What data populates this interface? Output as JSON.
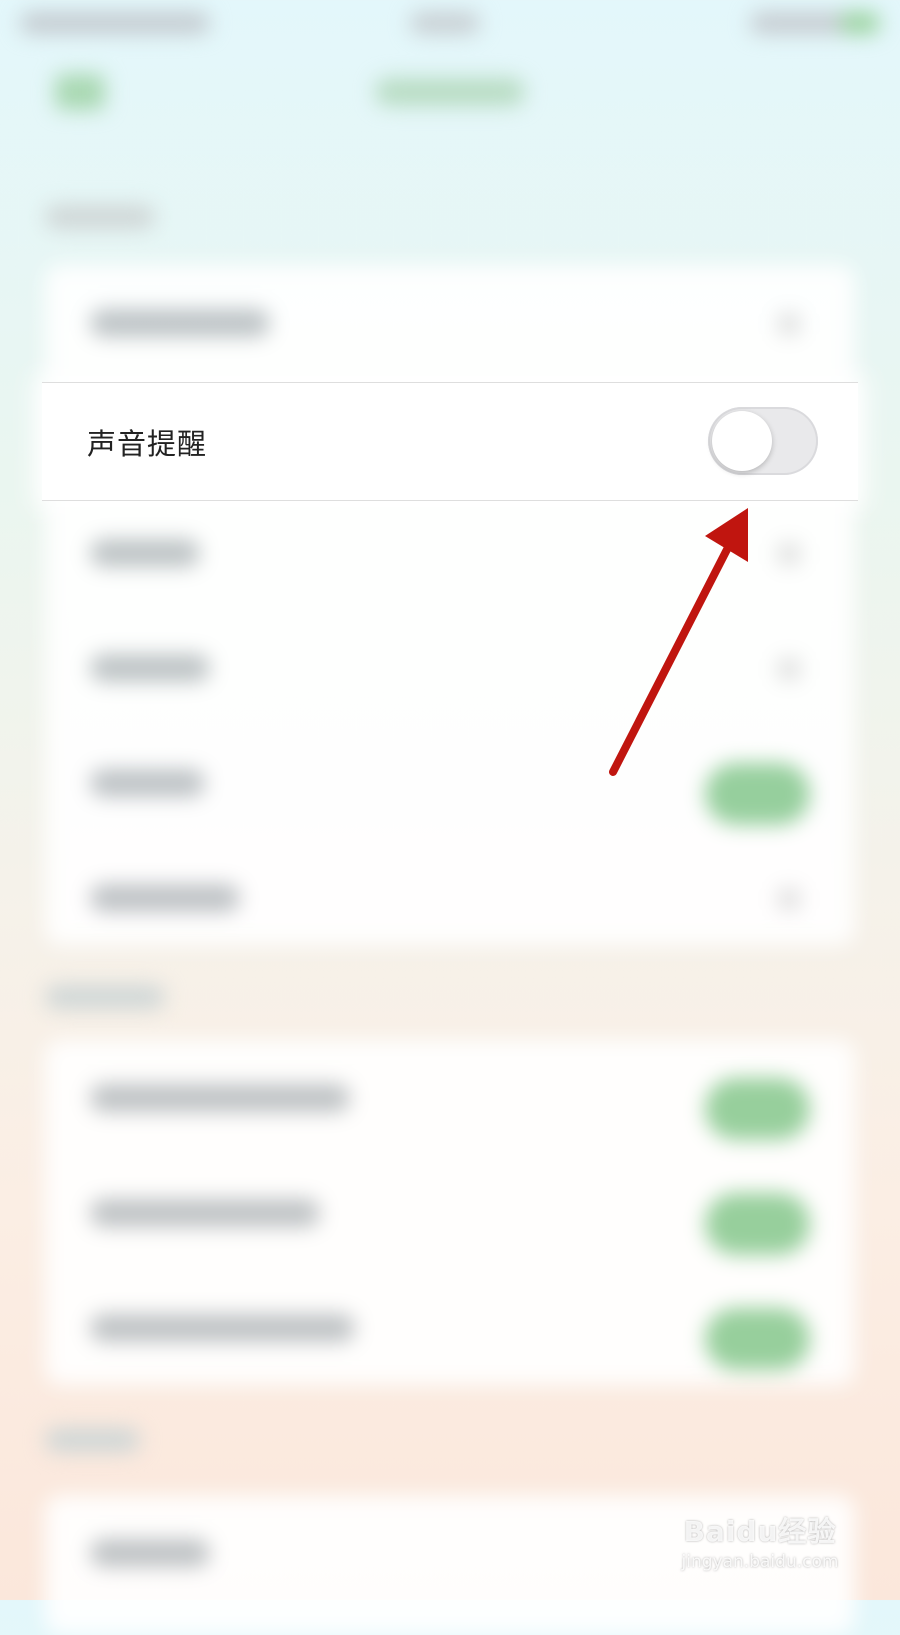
{
  "settings": {
    "sound_reminder_label": "声音提醒",
    "sound_reminder_enabled": false
  },
  "watermark": {
    "brand": "Baidu经验",
    "url": "jingyan.baidu.com"
  },
  "colors": {
    "annotation_arrow": "#c0150f",
    "switch_off": "#e9e9eb",
    "switch_on_blurred": "#8fcc96"
  }
}
